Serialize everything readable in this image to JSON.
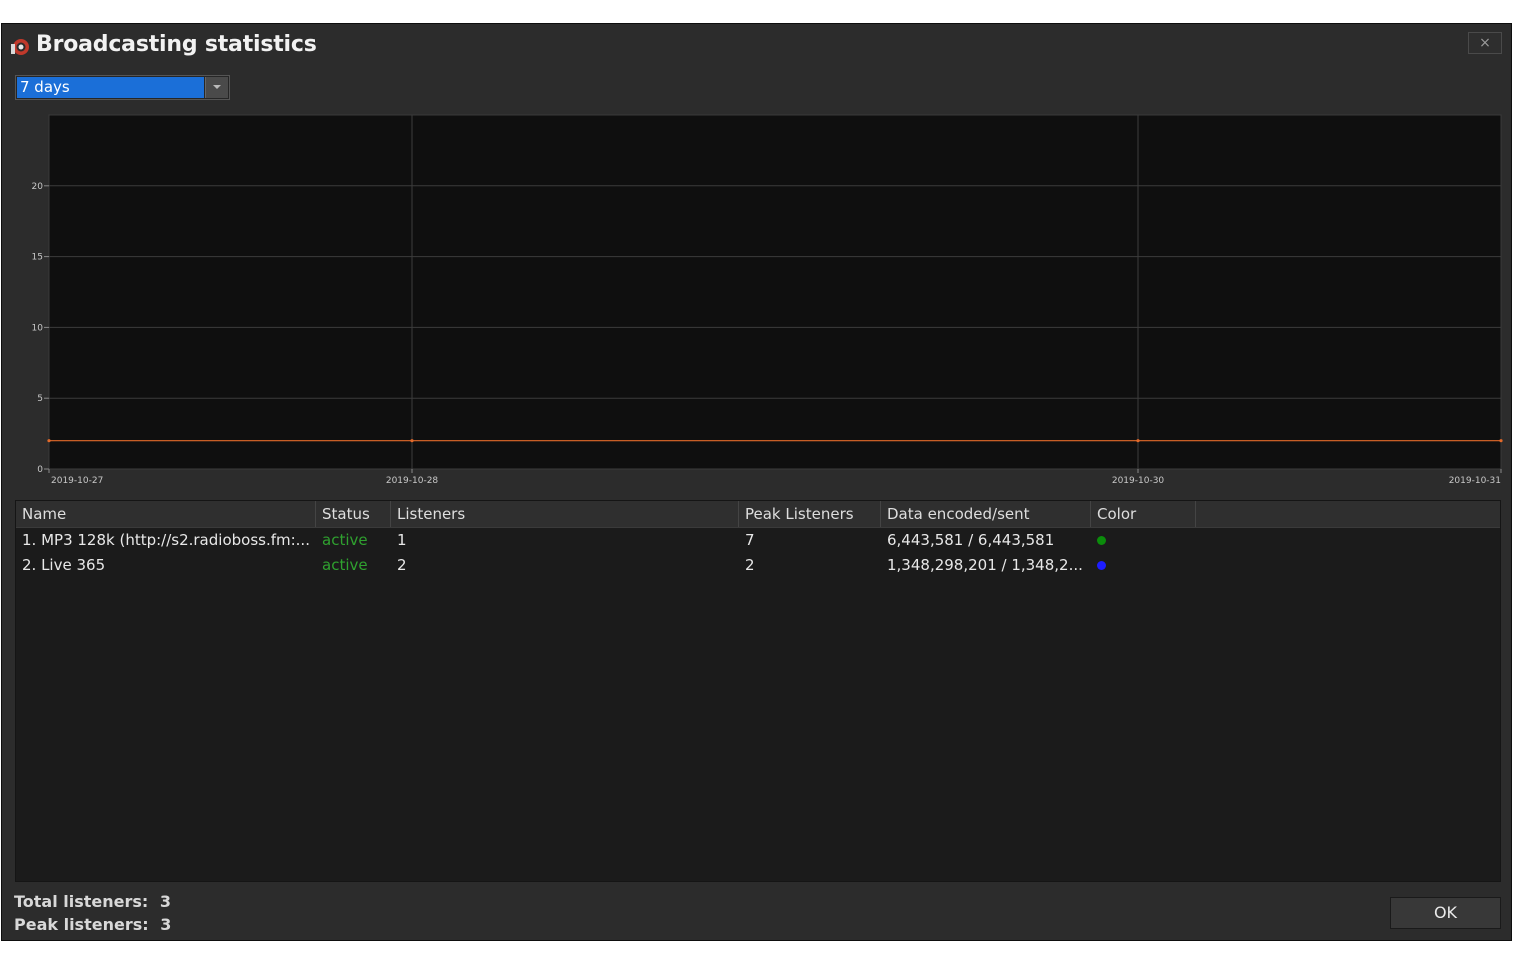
{
  "window": {
    "title": "Broadcasting statistics",
    "close_label": "×"
  },
  "period": {
    "selected": "7 days"
  },
  "chart_data": {
    "type": "line",
    "y_ticks": [
      "0",
      "5",
      "10",
      "15",
      "20"
    ],
    "ylim": [
      0,
      25
    ],
    "x_ticks": [
      "2019-10-27",
      "2019-10-28",
      "2019-10-30",
      "2019-10-31"
    ],
    "grid": true,
    "series": [
      {
        "color": "#e36a2a",
        "x": [
          "2019-10-27",
          "2019-10-28",
          "2019-10-30",
          "2019-10-31"
        ],
        "values": [
          2,
          2,
          2,
          2
        ]
      }
    ]
  },
  "table": {
    "columns": [
      "Name",
      "Status",
      "Listeners",
      "Peak Listeners",
      "Data encoded/sent",
      "Color"
    ],
    "rows": [
      {
        "name": "1. MP3 128k (http://s2.radioboss.fm:...",
        "status": "active",
        "listeners": "1",
        "peak": "7",
        "data": "6,443,581 / 6,443,581",
        "color": "#0b8c0b"
      },
      {
        "name": "2. Live 365",
        "status": "active",
        "listeners": "2",
        "peak": "2",
        "data": "1,348,298,201 / 1,348,2...",
        "color": "#1d1dff"
      }
    ],
    "status_color": "#2fa12f"
  },
  "footer": {
    "total_label": "Total listeners:",
    "total_value": "3",
    "peak_label": "Peak listeners:",
    "peak_value": "3",
    "ok_label": "OK"
  }
}
